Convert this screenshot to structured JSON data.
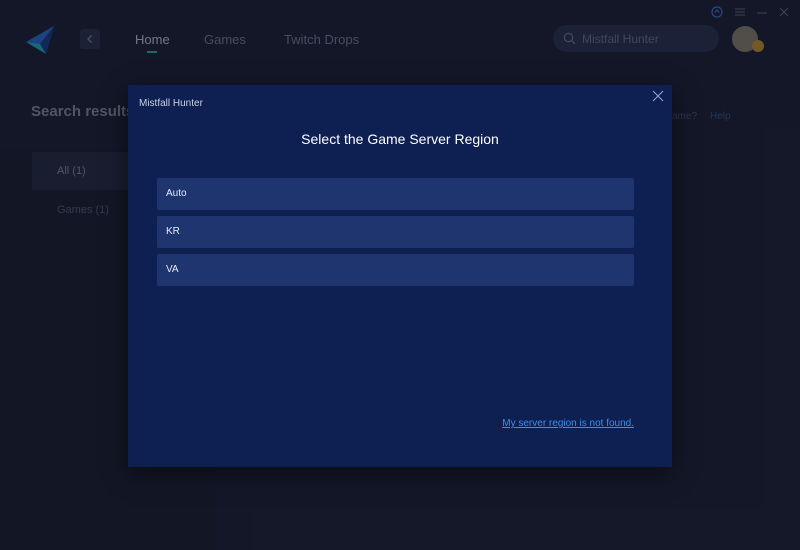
{
  "nav": {
    "tabs": [
      {
        "label": "Home",
        "active": true
      },
      {
        "label": "Games",
        "active": false
      },
      {
        "label": "Twitch Drops",
        "active": false
      }
    ],
    "search_value": "Mistfall Hunter"
  },
  "background": {
    "page_title": "Search results",
    "side_tabs": [
      {
        "label": "All (1)",
        "active": true
      },
      {
        "label": "Games (1)",
        "active": false
      }
    ],
    "partial_link": "ame?",
    "help_link": "Help"
  },
  "modal": {
    "game_name": "Mistfall Hunter",
    "title": "Select the Game Server Region",
    "regions": [
      "Auto",
      "KR",
      "VA"
    ],
    "not_found_link": "My server region is not found."
  },
  "colors": {
    "modal_bg": "#0e1f52",
    "option_bg": "#1f3570",
    "link": "#3f8fe6",
    "nav_accent": "#2ab3b0"
  },
  "icons": [
    "app-logo-icon",
    "chevron-left-icon",
    "search-icon",
    "upload-icon",
    "menu-icon",
    "minimize-icon",
    "close-icon"
  ]
}
